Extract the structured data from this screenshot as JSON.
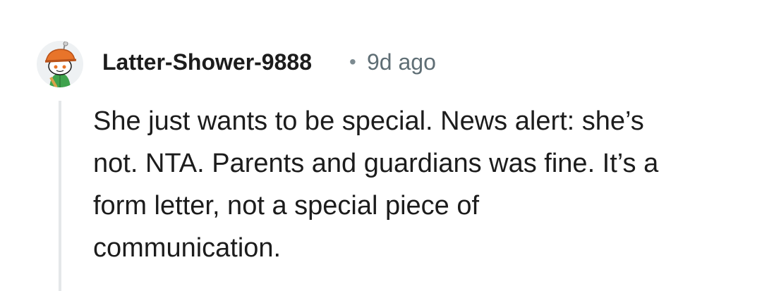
{
  "comment": {
    "avatar_icon": "snoo-avatar-icon",
    "username": "Latter-Shower-9888",
    "separator": "•",
    "time_ago": "9d ago",
    "body_lines": [
      "She just wants to be special. News alert: she’s",
      "not. NTA. Parents and guardians was fine. It’s a",
      "form letter, not a special piece of",
      "communication."
    ]
  },
  "colors": {
    "username": "#1c1c1c",
    "meta": "#5f6e75",
    "thread_line": "#e4e7e9",
    "avatar_hat": "#e8742a",
    "avatar_shirt": "#3fa34d"
  }
}
